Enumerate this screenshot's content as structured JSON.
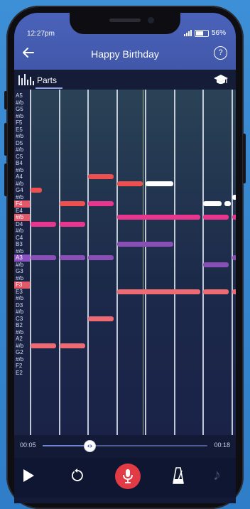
{
  "status": {
    "time": "12:27pm",
    "battery": "56%"
  },
  "header": {
    "title": "Happy Birthday",
    "help": "?"
  },
  "tabs": {
    "parts_label": "Parts"
  },
  "keys": [
    "A5",
    "#/b",
    "G5",
    "#/b",
    "F5",
    "E5",
    "#/b",
    "D5",
    "#/b",
    "C5",
    "B4",
    "#/b",
    "A4",
    "#/b",
    "G4",
    "#/b",
    "F4",
    "E4",
    "#/b",
    "D4",
    "#/b",
    "C4",
    "B3",
    "#/b",
    "A3",
    "#/b",
    "G3",
    "#/b",
    "F3",
    "E3",
    "#/b",
    "D3",
    "#/b",
    "C3",
    "B2",
    "#/b",
    "A2",
    "#/b",
    "G2",
    "#/b",
    "F2",
    "E2"
  ],
  "highlighted_keys": {
    "red": [
      16,
      18,
      28
    ],
    "purple": [
      24
    ]
  },
  "colors": {
    "red": "#ee4f4f",
    "pink": "#e8368e",
    "purple": "#8a4fb6",
    "salmon": "#ef6b73",
    "white": "#ffffff"
  },
  "notes": [
    {
      "pitch": 14,
      "start": 0.0,
      "end": 0.45,
      "color": "red"
    },
    {
      "pitch": 19,
      "start": 0.0,
      "end": 0.95,
      "color": "pink"
    },
    {
      "pitch": 24,
      "start": 0.0,
      "end": 0.95,
      "color": "purple"
    },
    {
      "pitch": 37,
      "start": 0.0,
      "end": 0.95,
      "color": "salmon"
    },
    {
      "pitch": 16,
      "start": 1.0,
      "end": 1.95,
      "color": "red"
    },
    {
      "pitch": 19,
      "start": 1.0,
      "end": 1.95,
      "color": "pink"
    },
    {
      "pitch": 24,
      "start": 1.0,
      "end": 1.95,
      "color": "purple"
    },
    {
      "pitch": 37,
      "start": 1.0,
      "end": 1.95,
      "color": "salmon"
    },
    {
      "pitch": 12,
      "start": 2.0,
      "end": 2.95,
      "color": "red"
    },
    {
      "pitch": 16,
      "start": 2.0,
      "end": 2.95,
      "color": "pink"
    },
    {
      "pitch": 24,
      "start": 2.0,
      "end": 2.95,
      "color": "purple"
    },
    {
      "pitch": 33,
      "start": 2.0,
      "end": 2.95,
      "color": "salmon"
    },
    {
      "pitch": 13,
      "start": 3.0,
      "end": 3.95,
      "color": "red"
    },
    {
      "pitch": 13,
      "start": 4.0,
      "end": 5.0,
      "color": "white"
    },
    {
      "pitch": 18,
      "start": 3.0,
      "end": 5.95,
      "color": "pink"
    },
    {
      "pitch": 22,
      "start": 3.0,
      "end": 5.0,
      "color": "purple"
    },
    {
      "pitch": 29,
      "start": 3.0,
      "end": 5.95,
      "color": "salmon"
    },
    {
      "pitch": 16,
      "start": 6.0,
      "end": 6.7,
      "color": "white"
    },
    {
      "pitch": 16,
      "start": 6.75,
      "end": 7.0,
      "color": "white"
    },
    {
      "pitch": 18,
      "start": 6.0,
      "end": 6.95,
      "color": "pink"
    },
    {
      "pitch": 25,
      "start": 6.0,
      "end": 6.95,
      "color": "purple"
    },
    {
      "pitch": 29,
      "start": 6.0,
      "end": 6.95,
      "color": "salmon"
    },
    {
      "pitch": 15,
      "start": 7.0,
      "end": 8.0,
      "color": "white"
    },
    {
      "pitch": 18,
      "start": 7.0,
      "end": 8.0,
      "color": "pink"
    },
    {
      "pitch": 24,
      "start": 7.0,
      "end": 8.0,
      "color": "purple"
    },
    {
      "pitch": 29,
      "start": 7.0,
      "end": 8.0,
      "color": "salmon"
    }
  ],
  "playback": {
    "elapsed": "00:05",
    "total": "00:18",
    "progress": 0.28
  }
}
